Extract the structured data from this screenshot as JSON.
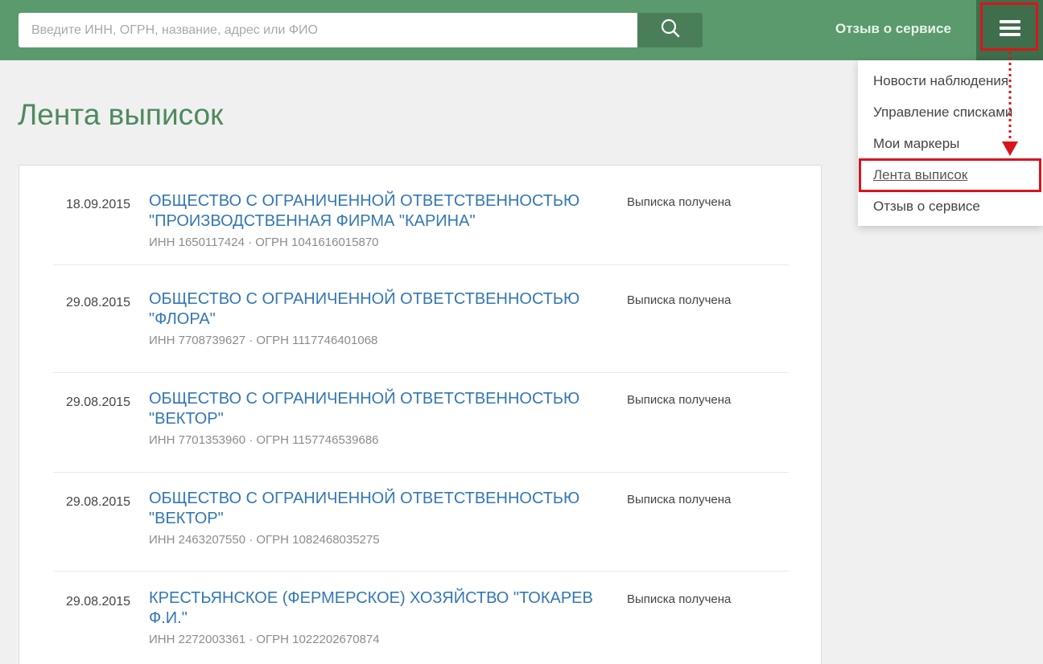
{
  "header": {
    "search_placeholder": "Введите ИНН, ОГРН, название, адрес или ФИО",
    "search_icon": "search-icon",
    "feedback_label": "Отзыв о сервисе",
    "menu_icon": "hamburger-menu-icon",
    "bar_color": "#5b9a6c",
    "accent_color": "#d9151b"
  },
  "page": {
    "title": "Лента выписок"
  },
  "menu": {
    "items": [
      {
        "label": "Новости наблюдения"
      },
      {
        "label": "Управление списками"
      },
      {
        "label": "Мои маркеры"
      },
      {
        "label": "Лента выписок"
      },
      {
        "label": "Отзыв о сервисе"
      }
    ]
  },
  "feed": {
    "items": [
      {
        "date": "18.09.2015",
        "name": "ОБЩЕСТВО С ОГРАНИЧЕННОЙ ОТВЕТСТВЕННОСТЬЮ \"ПРОИЗВОДСТВЕННАЯ ФИРМА \"КАРИНА\"",
        "ids": "ИНН 1650117424 · ОГРН 1041616015870",
        "status": "Выписка получена"
      },
      {
        "date": "29.08.2015",
        "name": "ОБЩЕСТВО С ОГРАНИЧЕННОЙ ОТВЕТСТВЕННОСТЬЮ \"ФЛОРА\"",
        "ids": "ИНН 7708739627 · ОГРН 1117746401068",
        "status": "Выписка получена"
      },
      {
        "date": "29.08.2015",
        "name": "ОБЩЕСТВО С ОГРАНИЧЕННОЙ ОТВЕТСТВЕННОСТЬЮ \"ВЕКТОР\"",
        "ids": "ИНН 7701353960 · ОГРН 1157746539686",
        "status": "Выписка получена"
      },
      {
        "date": "29.08.2015",
        "name": "ОБЩЕСТВО С ОГРАНИЧЕННОЙ ОТВЕТСТВЕННОСТЬЮ \"ВЕКТОР\"",
        "ids": "ИНН 2463207550 · ОГРН 1082468035275",
        "status": "Выписка получена"
      },
      {
        "date": "29.08.2015",
        "name": "КРЕСТЬЯНСКОЕ (ФЕРМЕРСКОЕ) ХОЗЯЙСТВО \"ТОКАРЕВ Ф.И.\"",
        "ids": "ИНН 2272003361 · ОГРН 1022202670874",
        "status": "Выписка получена"
      }
    ]
  }
}
